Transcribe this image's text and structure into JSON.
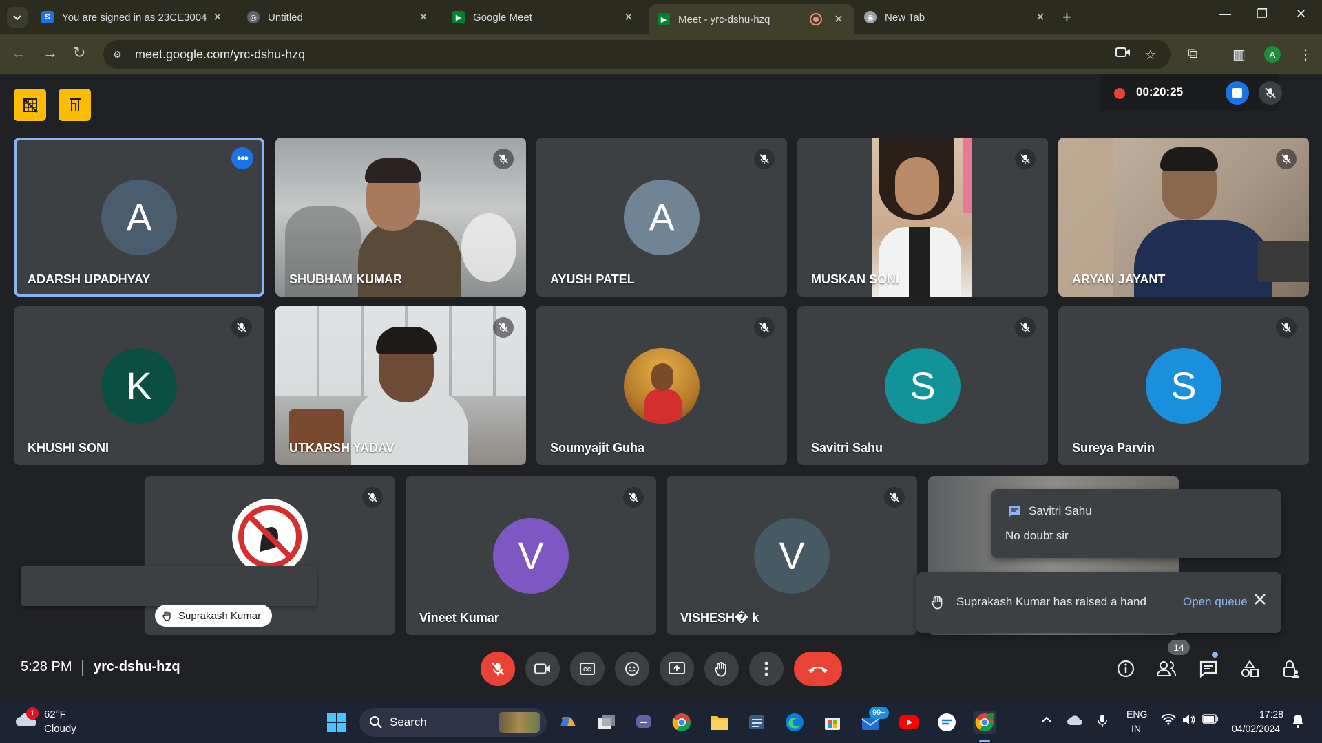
{
  "browser": {
    "tabs": [
      {
        "label": "You are signed in as 23CE3004"
      },
      {
        "label": "Untitled"
      },
      {
        "label": "Google Meet"
      },
      {
        "label": "Meet - yrc-dshu-hzq"
      },
      {
        "label": "New Tab"
      }
    ],
    "url": "meet.google.com/yrc-dshu-hzq",
    "profile_initial": "A"
  },
  "recording": {
    "time": "00:20:25"
  },
  "tiles": [
    {
      "name": "ADARSH UPADHYAY",
      "initial": "A",
      "color": "#4a5d6e"
    },
    {
      "name": "SHUBHAM KUMAR"
    },
    {
      "name": "AYUSH PATEL",
      "initial": "A",
      "color": "#6f8596"
    },
    {
      "name": "MUSKAN SONI"
    },
    {
      "name": "ARYAN JAYANT"
    },
    {
      "name": "KHUSHI SONI",
      "initial": "K",
      "color": "#0b4f43"
    },
    {
      "name": "UTKARSH YADAV"
    },
    {
      "name": "Soumyajit Guha"
    },
    {
      "name": "Savitri Sahu",
      "initial": "S",
      "color": "#12939a"
    },
    {
      "name": "Sureya Parvin",
      "initial": "S",
      "color": "#1a8fdc"
    },
    {
      "name": "Suprakash Kumar"
    },
    {
      "name": "Vineet Kumar",
      "initial": "V",
      "color": "#7e57c2"
    },
    {
      "name": "VISHESH� k",
      "initial": "V",
      "color": "#455a64"
    }
  ],
  "notifications": {
    "chat_from": "Savitri Sahu",
    "chat_message": "No doubt sir",
    "hand_text": "Suprakash Kumar has raised a hand",
    "open_queue": "Open queue"
  },
  "meeting": {
    "time": "5:28 PM",
    "code": "yrc-dshu-hzq",
    "participant_count": "14"
  },
  "taskbar": {
    "weather_temp": "62°F",
    "weather_desc": "Cloudy",
    "weather_badge": "1",
    "search_label": "Search",
    "mail_badge": "99+",
    "lang_line1": "ENG",
    "lang_line2": "IN",
    "clock_time": "17:28",
    "clock_date": "04/02/2024"
  },
  "colors": {
    "accent": "#1a73e8",
    "danger": "#ea4335",
    "highlight": "#fbbc04"
  }
}
